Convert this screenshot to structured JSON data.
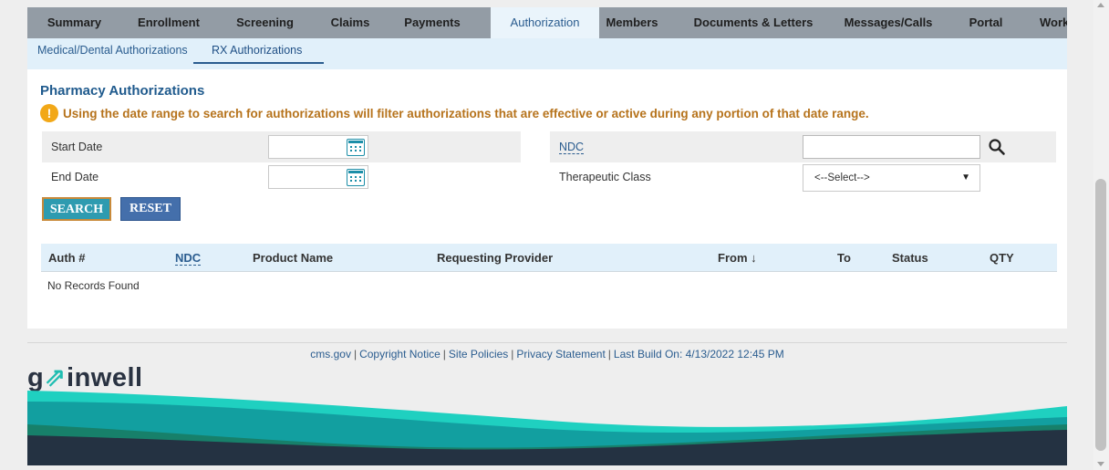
{
  "tabs": [
    {
      "label": "Summary"
    },
    {
      "label": "Enrollment"
    },
    {
      "label": "Screening"
    },
    {
      "label": "Claims"
    },
    {
      "label": "Payments"
    },
    {
      "label": "Authorization"
    },
    {
      "label": "Members"
    },
    {
      "label": "Documents & Letters"
    },
    {
      "label": "Messages/Calls"
    },
    {
      "label": "Portal"
    },
    {
      "label": "Work"
    }
  ],
  "active_tab": "Authorization",
  "subtabs": [
    {
      "label": "Medical/Dental Authorizations"
    },
    {
      "label": "RX Authorizations"
    }
  ],
  "active_subtab": "RX Authorizations",
  "page": {
    "title": "Pharmacy Authorizations",
    "notice_icon": "!",
    "notice": "Using the date range to search for authorizations will filter authorizations that are effective or active during any portion of that date range."
  },
  "form": {
    "start_date_label": "Start Date",
    "start_date_value": "",
    "end_date_label": "End Date",
    "end_date_value": "",
    "ndc_label": "NDC",
    "ndc_value": "",
    "therapeutic_class_label": "Therapeutic Class",
    "therapeutic_class_selected": "<--Select-->"
  },
  "buttons": {
    "search": "SEARCH",
    "reset": "RESET"
  },
  "table": {
    "columns": [
      "Auth #",
      "NDC",
      "Product Name",
      "Requesting Provider",
      "From ↓",
      "To",
      "Status",
      "QTY"
    ],
    "empty_message": "No Records Found"
  },
  "footer": {
    "links": [
      "cms.gov",
      "Copyright Notice",
      "Site Policies",
      "Privacy Statement"
    ],
    "build": "Last Build On: 4/13/2022 12:45 PM",
    "separator": "|",
    "logo_text_left": "g",
    "logo_text_accent": "⇗",
    "logo_text_right": "inwell"
  },
  "colors": {
    "tab_bar": "#939ca5",
    "active_tab_bg": "#eaf4fb",
    "subbar": "#e1f0fa",
    "title_blue": "#1f5a8d",
    "notice_orange": "#b6731c",
    "search_button": "#2e9bb0",
    "reset_button": "#446fab",
    "wave_teal": "#14b5a8",
    "wave_dark": "#243242"
  }
}
